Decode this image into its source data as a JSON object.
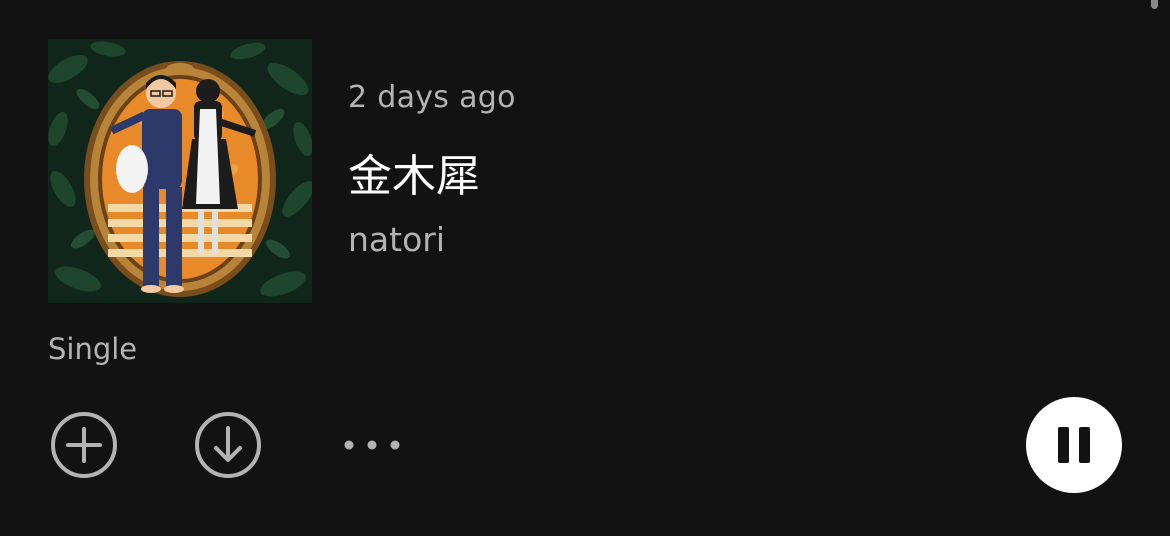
{
  "release": {
    "date_label": "2 days ago",
    "title": "金木犀",
    "artist": "natori",
    "type": "Single"
  },
  "colors": {
    "background": "#121212",
    "secondary_text": "#b3b3b3",
    "primary_text": "#ffffff",
    "icon_gray": "#b3b3b3",
    "play_button_bg": "#ffffff",
    "cover_orange": "#e88a2c",
    "cover_green": "#1a3a26",
    "frame_gold": "#a8732e",
    "pajama_navy": "#2b3a6b"
  },
  "controls": {
    "add_icon": "plus-circle-icon",
    "download_icon": "download-circle-icon",
    "more_icon": "ellipsis-icon",
    "playback_icon": "pause-icon",
    "playback_state": "playing"
  }
}
